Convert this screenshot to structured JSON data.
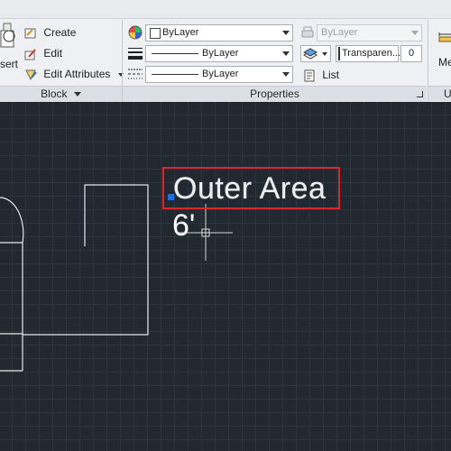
{
  "ribbon": {
    "block": {
      "insert_label": "sert",
      "create_label": "Create",
      "edit_label": "Edit",
      "edit_attributes_label": "Edit Attributes",
      "panel_title": "Block"
    },
    "properties": {
      "color_value": "ByLayer",
      "linetype_value": "ByLayer",
      "lineweight_value": "ByLayer",
      "plotstyle_value": "ByLayer",
      "transparency_label": "Transparen...",
      "transparency_value": "0",
      "list_label": "List",
      "panel_title": "Properties"
    },
    "utilities": {
      "measure_label": "Me",
      "panel_title": "U"
    }
  },
  "drawing": {
    "text_outer_area": "Outer Area",
    "text_dimension": "6'",
    "highlight_color": "#e0232a",
    "grip_color": "#1f6fe0"
  }
}
